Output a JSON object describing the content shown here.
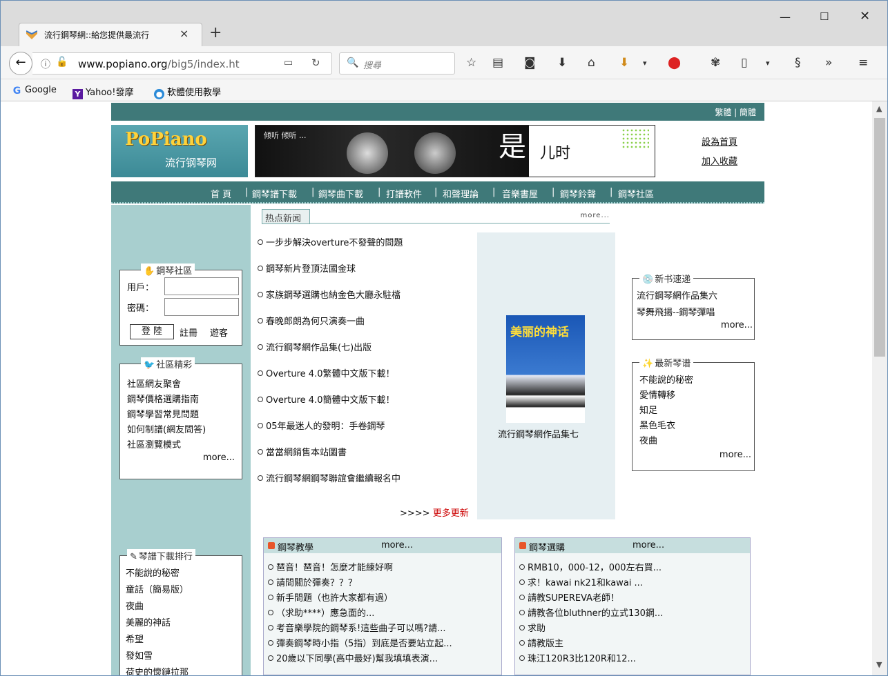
{
  "browser": {
    "tab_title": "流行鋼琴網::給您提供最流行",
    "url_domain": "www.popiano.org",
    "url_path": "/big5/index.ht",
    "search_placeholder": "搜尋",
    "bookmarks": [
      "Google",
      "Yahoo!發摩",
      "軟體使用教學"
    ]
  },
  "page": {
    "topstrip_link": "繁體 | 簡體",
    "logo_brand": "PoPiano",
    "logo_sub": "流行钢琴网",
    "banner_text1": "倾听 倾听 ...",
    "banner_text2": "是",
    "banner_text3": "儿时",
    "side_links": [
      "設為首頁",
      "加入收藏"
    ],
    "nav": [
      "首 頁",
      "鋼琴譜下載",
      "鋼琴曲下載",
      "打譜軟件",
      "和聲理論",
      "音樂書屋",
      "鋼琴鈴聲",
      "鋼琴社區"
    ],
    "nav_sep": "|",
    "community": {
      "legend": "鋼琴社區",
      "user_label": "用戶：",
      "pass_label": "密碼：",
      "login": "登 陸",
      "register": "註冊",
      "guest": "遊客"
    },
    "highlights": {
      "legend": "社區精彩",
      "items": [
        "社區網友聚會",
        "鋼琴價格選購指南",
        "鋼琴學習常見問題",
        "如何制譜(網友問答)",
        "社區瀏覽模式"
      ],
      "more": "more..."
    },
    "rank": {
      "legend": "琴譜下載排行",
      "items": [
        "不能說的秘密",
        "童話（簡易版）",
        "夜曲",
        "美麗的神話",
        "希望",
        "發如雪",
        "荷史的懷鏈拉那"
      ]
    },
    "news": {
      "header": "热点新闻",
      "more": "more...",
      "items": [
        "一步步解決overture不發聲的問題",
        "鋼琴新片登頂法國金球",
        "家族鋼琴選購也納金色大廳永駐檔",
        "春晚郎朗為何只演奏一曲",
        "流行鋼琴網作品集(七)出版",
        "Overture 4.0繁體中文版下載！",
        "Overture 4.0簡體中文版下載！",
        "05年最迷人的發明：手卷鋼琴",
        "當當網銷售本站圖書",
        "流行鋼琴網鋼琴聯誼會繼續報名中"
      ],
      "more_updates_prefix": ">>>>",
      "more_updates": "更多更新"
    },
    "book": {
      "cover_title": "美丽的神话",
      "caption": "流行鋼琴網作品集七"
    },
    "newbooks": {
      "legend": "新书速递",
      "items": [
        "流行鋼琴網作品集六",
        "琴舞飛揚--鋼琴彈唱"
      ],
      "more": "more..."
    },
    "newscores": {
      "legend": "最新琴谱",
      "items": [
        "不能說的秘密",
        "愛情轉移",
        "知足",
        "黑色毛衣",
        "夜曲"
      ],
      "more": "more..."
    },
    "teaching": {
      "title": "鋼琴教學",
      "more": "more...",
      "items": [
        "琶音！琶音！怎麼才能練好啊",
        "請問關於彈奏？？？",
        "新手問題（也許大家都有過）",
        "（求助****）應急面的...",
        "考音樂學院的鋼琴系!這些曲子可以嗎?請...",
        "彈奏鋼琴時小指（5指）到底是否要站立起...",
        "20歲以下同學(高中最好)幫我填填表演..."
      ]
    },
    "choose": {
      "title": "鋼琴選購",
      "more": "more...",
      "items": [
        "RMB10，000-12，000左右買...",
        "求！kawai nk21和kawai ...",
        "請教SUPEREVA老師！",
        "請教各位bluthner的立式130鋼...",
        "求助",
        "請教版主",
        "珠江120R3比120R和12..."
      ]
    }
  }
}
